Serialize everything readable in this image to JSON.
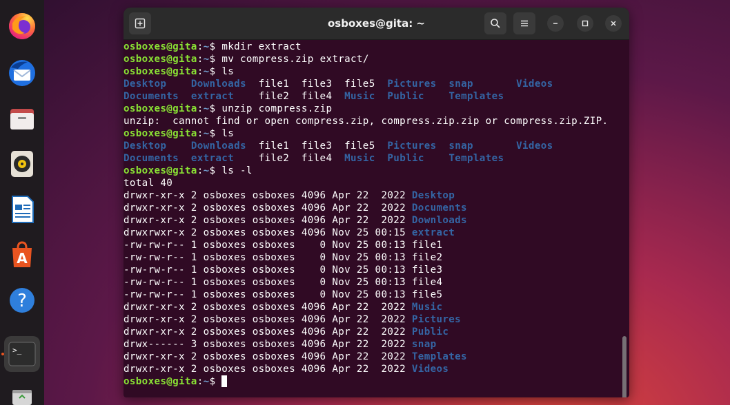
{
  "window": {
    "title": "osboxes@gita: ~"
  },
  "dock": {
    "items": [
      {
        "name": "firefox-icon"
      },
      {
        "name": "thunderbird-icon"
      },
      {
        "name": "files-icon"
      },
      {
        "name": "rhythmbox-icon"
      },
      {
        "name": "libreoffice-writer-icon"
      },
      {
        "name": "app-center-icon"
      },
      {
        "name": "help-icon"
      },
      {
        "name": "terminal-icon",
        "label": ">_"
      },
      {
        "name": "trash-icon"
      }
    ]
  },
  "terminal": {
    "prompt_user": "osboxes@gita",
    "prompt_sep": ":",
    "prompt_path": "~",
    "prompt_sign": "$ ",
    "commands": [
      "mkdir extract",
      "mv compress.zip extract/",
      "ls",
      "unzip compress.zip",
      "ls",
      "ls -l"
    ],
    "ls_output": {
      "row1": [
        {
          "t": "Desktop",
          "dir": true
        },
        {
          "t": "    ",
          "dir": false
        },
        {
          "t": "Downloads",
          "dir": true
        },
        {
          "t": "  file1  file3  file5  ",
          "dir": false
        },
        {
          "t": "Pictures",
          "dir": true
        },
        {
          "t": "  ",
          "dir": false
        },
        {
          "t": "snap",
          "dir": true
        },
        {
          "t": "       ",
          "dir": false
        },
        {
          "t": "Videos",
          "dir": true
        }
      ],
      "row2": [
        {
          "t": "Documents",
          "dir": true
        },
        {
          "t": "  ",
          "dir": false
        },
        {
          "t": "extract",
          "dir": true
        },
        {
          "t": "    file2  file4  ",
          "dir": false
        },
        {
          "t": "Music",
          "dir": true
        },
        {
          "t": "  ",
          "dir": false
        },
        {
          "t": "Public",
          "dir": true
        },
        {
          "t": "    ",
          "dir": false
        },
        {
          "t": "Templates",
          "dir": true
        }
      ]
    },
    "unzip_error": "unzip:  cannot find or open compress.zip, compress.zip.zip or compress.zip.ZIP.",
    "total": "total 40",
    "long_listing": [
      {
        "meta": "drwxr-xr-x 2 osboxes osboxes 4096 Apr 22  2022 ",
        "name": "Desktop",
        "dir": true
      },
      {
        "meta": "drwxr-xr-x 2 osboxes osboxes 4096 Apr 22  2022 ",
        "name": "Documents",
        "dir": true
      },
      {
        "meta": "drwxr-xr-x 2 osboxes osboxes 4096 Apr 22  2022 ",
        "name": "Downloads",
        "dir": true
      },
      {
        "meta": "drwxrwxr-x 2 osboxes osboxes 4096 Nov 25 00:15 ",
        "name": "extract",
        "dir": true
      },
      {
        "meta": "-rw-rw-r-- 1 osboxes osboxes    0 Nov 25 00:13 ",
        "name": "file1",
        "dir": false
      },
      {
        "meta": "-rw-rw-r-- 1 osboxes osboxes    0 Nov 25 00:13 ",
        "name": "file2",
        "dir": false
      },
      {
        "meta": "-rw-rw-r-- 1 osboxes osboxes    0 Nov 25 00:13 ",
        "name": "file3",
        "dir": false
      },
      {
        "meta": "-rw-rw-r-- 1 osboxes osboxes    0 Nov 25 00:13 ",
        "name": "file4",
        "dir": false
      },
      {
        "meta": "-rw-rw-r-- 1 osboxes osboxes    0 Nov 25 00:13 ",
        "name": "file5",
        "dir": false
      },
      {
        "meta": "drwxr-xr-x 2 osboxes osboxes 4096 Apr 22  2022 ",
        "name": "Music",
        "dir": true
      },
      {
        "meta": "drwxr-xr-x 2 osboxes osboxes 4096 Apr 22  2022 ",
        "name": "Pictures",
        "dir": true
      },
      {
        "meta": "drwxr-xr-x 2 osboxes osboxes 4096 Apr 22  2022 ",
        "name": "Public",
        "dir": true
      },
      {
        "meta": "drwx------ 3 osboxes osboxes 4096 Apr 22  2022 ",
        "name": "snap",
        "dir": true
      },
      {
        "meta": "drwxr-xr-x 2 osboxes osboxes 4096 Apr 22  2022 ",
        "name": "Templates",
        "dir": true
      },
      {
        "meta": "drwxr-xr-x 2 osboxes osboxes 4096 Apr 22  2022 ",
        "name": "Videos",
        "dir": true
      }
    ]
  },
  "colors": {
    "terminal_bg": "#300a24",
    "prompt_user": "#8ae234",
    "prompt_path": "#729fcf",
    "directory": "#3465a4",
    "accent": "#e95420"
  }
}
